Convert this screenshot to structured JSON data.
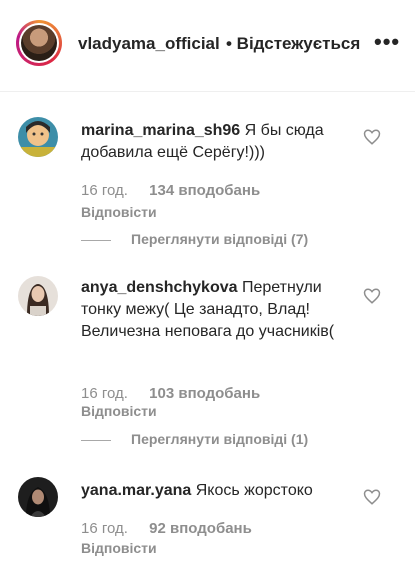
{
  "header": {
    "username": "vladyama_official",
    "follow_status": "• Відстежується",
    "more_icon": "more-icon"
  },
  "comments": [
    {
      "username": "marina_marina_sh96",
      "text": "Я бы сюда добавила ещё Серёгу!)))",
      "time": "16 год.",
      "likes": "134 вподобань",
      "reply": "Відповісти",
      "view_replies": "Переглянути відповіді (7)"
    },
    {
      "username": "anya_denshchykova",
      "text": "Перетнули тонку межу( Це занадто, Влад! Величезна неповага до учасників(",
      "time": "16 год.",
      "likes": "103 вподобань",
      "reply": "Відповісти",
      "view_replies": "Переглянути відповіді (1)"
    },
    {
      "username": "yana.mar.yana",
      "text": "Якось жорстоко",
      "time": "16 год.",
      "likes": "92 вподобань",
      "reply": "Відповісти"
    }
  ],
  "colors": {
    "text": "#262626",
    "secondary": "#8e8e8e"
  }
}
